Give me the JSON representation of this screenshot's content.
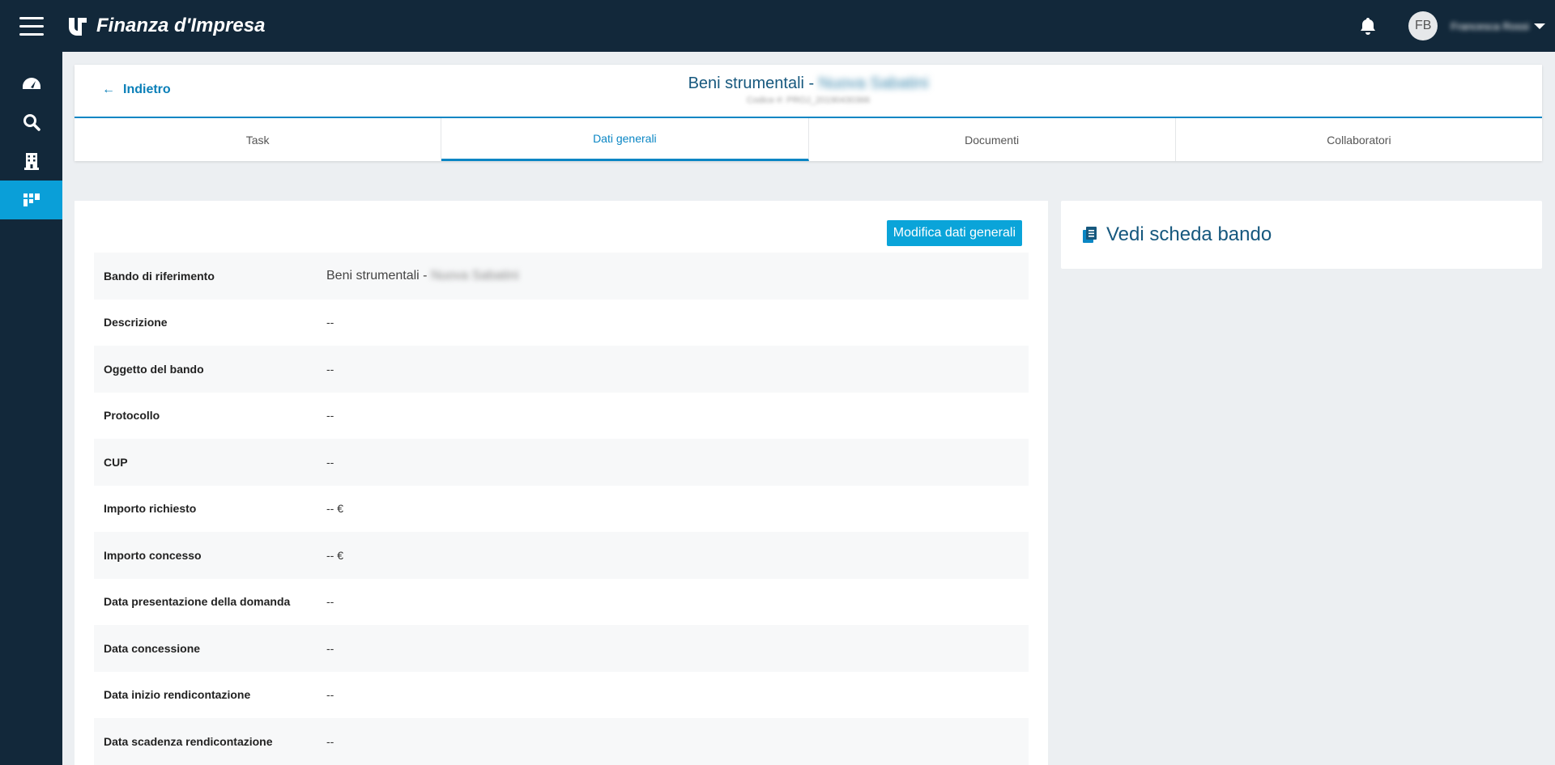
{
  "app": {
    "title": "Finanza d'Impresa",
    "user_initials": "FB",
    "user_name": "Francesca Rossi"
  },
  "header": {
    "back_label": "Indietro",
    "title_prefix": "Beni strumentali - ",
    "title_blurred": "Nuova Sabatini",
    "subtitle": "Codice #: PROJ_20190430366"
  },
  "tabs": [
    {
      "label": "Task"
    },
    {
      "label": "Dati generali"
    },
    {
      "label": "Documenti"
    },
    {
      "label": "Collaboratori"
    }
  ],
  "main": {
    "edit_button": "Modifica dati generali",
    "rows": [
      {
        "label": "Bando di riferimento",
        "value": "Beni strumentali - ",
        "value_blurred": "Nuova Sabatini"
      },
      {
        "label": "Descrizione",
        "value": "--"
      },
      {
        "label": "Oggetto del bando",
        "value": "--"
      },
      {
        "label": "Protocollo",
        "value": "--"
      },
      {
        "label": "CUP",
        "value": "--"
      },
      {
        "label": "Importo richiesto",
        "value": "-- €"
      },
      {
        "label": "Importo concesso",
        "value": "-- €"
      },
      {
        "label": "Data presentazione della domanda",
        "value": "--"
      },
      {
        "label": "Data concessione",
        "value": "--"
      },
      {
        "label": "Data inizio rendicontazione",
        "value": "--"
      },
      {
        "label": "Data scadenza rendicontazione",
        "value": "--"
      }
    ]
  },
  "side_card": {
    "label": "Vedi scheda bando",
    "icon": "clipboard-icon"
  },
  "sidebar": {
    "items": [
      {
        "icon": "dashboard-icon"
      },
      {
        "icon": "search-icon"
      },
      {
        "icon": "building-icon"
      },
      {
        "icon": "projects-icon"
      }
    ]
  },
  "colors": {
    "topbar": "#12283a",
    "accent": "#0a9fd8",
    "title": "#16587e"
  }
}
